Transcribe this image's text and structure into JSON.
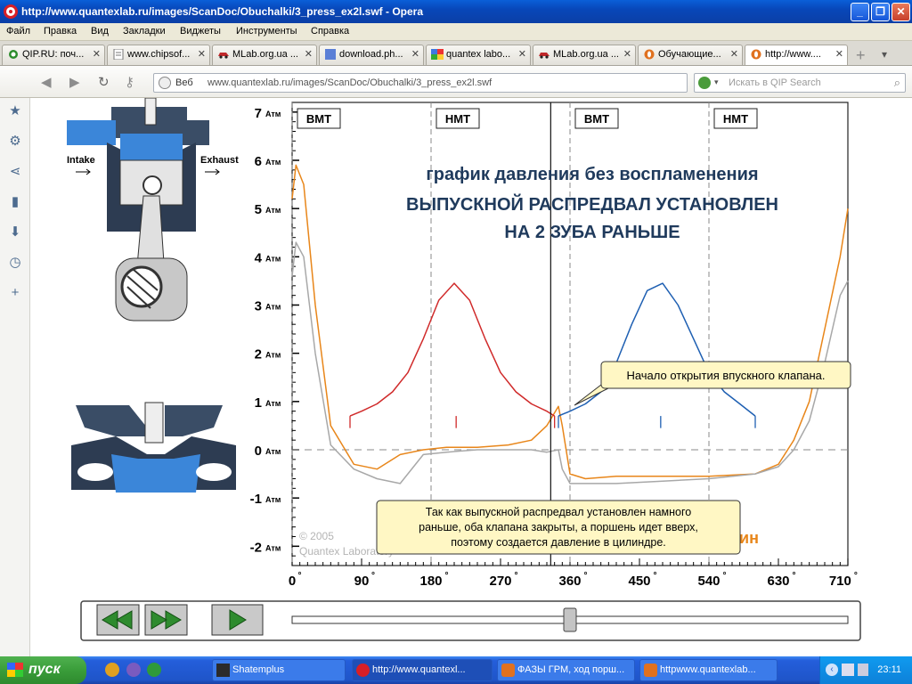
{
  "window": {
    "title": "http://www.quantexlab.ru/images/ScanDoc/Obuchalki/3_press_ex2l.swf - Opera",
    "buttons": {
      "minimize": "_",
      "maximize": "❐",
      "close": "✕"
    }
  },
  "menu": [
    "Файл",
    "Правка",
    "Вид",
    "Закладки",
    "Виджеты",
    "Инструменты",
    "Справка"
  ],
  "tabs": [
    {
      "label": "QIP.RU: поч...",
      "icon": "qip-icon"
    },
    {
      "label": "www.chipsof...",
      "icon": "page-icon"
    },
    {
      "label": "MLab.org.ua ...",
      "icon": "car-icon"
    },
    {
      "label": "download.ph...",
      "icon": "blue-page-icon"
    },
    {
      "label": "quantex labo...",
      "icon": "google-icon"
    },
    {
      "label": "MLab.org.ua ...",
      "icon": "car-icon"
    },
    {
      "label": "Обучающие...",
      "icon": "opera-icon"
    },
    {
      "label": "http://www....",
      "icon": "opera-icon"
    }
  ],
  "address": {
    "web_label": "Веб",
    "url": "www.quantexlab.ru/images/ScanDoc/Obuchalki/3_press_ex2l.swf",
    "search_placeholder": "Искать в QIP Search"
  },
  "flash": {
    "intake_label": "Intake",
    "exhaust_label": "Exhaust",
    "title_line1": "график давления без воспламенения",
    "title_line2": "ВЫПУСКНОЙ РАСПРЕДВАЛ УСТАНОВЛЕН",
    "title_line3": "НА 2 ЗУБА РАНЬШЕ",
    "tdc_bdc_labels": [
      "ВМТ",
      "НМТ",
      "ВМТ",
      "НМТ"
    ],
    "callout_intake": "Начало открытия впускного клапана.",
    "callout_exhaust_lines": [
      "Так как выпускной распредвал установлен намного",
      "раньше, оба клапана закрыты, а поршень идет вверх,",
      "поэтому создается давление в цилиндре."
    ],
    "copyright_lines": [
      "© 2005",
      "Quantex Laboratory"
    ],
    "partial_word": "ин",
    "y_unit": "Атм",
    "x_unit": "°",
    "colors": {
      "orange": "#e8861a",
      "grey": "#a8a8a8",
      "red": "#d02a2a",
      "blue": "#1e5fb2",
      "title": "#1f3a5c"
    }
  },
  "chart_data": {
    "type": "line",
    "title": "график давления без воспламенения",
    "subtitle": "ВЫПУСКНОЙ РАСПРЕДВАЛ УСТАНОВЛЕН НА 2 ЗУБА РАНЬШЕ",
    "xlabel": "",
    "ylabel": "",
    "xlim": [
      0,
      720
    ],
    "ylim": [
      -2.4,
      7.2
    ],
    "x_ticks": [
      "0",
      "90",
      "180",
      "270",
      "360",
      "450",
      "540",
      "630",
      "710"
    ],
    "y_ticks": [
      "7",
      "6",
      "5",
      "4",
      "3",
      "2",
      "1",
      "0",
      "-1",
      "-2"
    ],
    "dashed_verticals": [
      0,
      180,
      360,
      540
    ],
    "cursor_x": 335,
    "zero_line": 0,
    "series": [
      {
        "color": "orange",
        "x": [
          0,
          5,
          15,
          30,
          50,
          80,
          110,
          140,
          170,
          200,
          240,
          280,
          310,
          330,
          345,
          350,
          360,
          380,
          420,
          480,
          540,
          600,
          630,
          650,
          670,
          690,
          710,
          720
        ],
        "y": [
          5.2,
          5.9,
          5.5,
          3.0,
          0.5,
          -0.3,
          -0.4,
          -0.1,
          0.0,
          0.05,
          0.05,
          0.1,
          0.2,
          0.5,
          0.9,
          0.5,
          -0.5,
          -0.6,
          -0.55,
          -0.55,
          -0.55,
          -0.5,
          -0.3,
          0.2,
          1.0,
          2.5,
          4.0,
          5.0
        ]
      },
      {
        "color": "grey",
        "x": [
          0,
          5,
          15,
          30,
          50,
          80,
          110,
          140,
          170,
          200,
          240,
          280,
          310,
          330,
          345,
          350,
          360,
          380,
          420,
          480,
          540,
          600,
          630,
          650,
          670,
          690,
          710,
          720
        ],
        "y": [
          3.6,
          4.3,
          4.0,
          2.0,
          0.1,
          -0.4,
          -0.6,
          -0.7,
          -0.1,
          -0.05,
          0.0,
          0.0,
          0.0,
          -0.05,
          0.0,
          -0.4,
          -0.7,
          -0.7,
          -0.7,
          -0.65,
          -0.6,
          -0.5,
          -0.35,
          0.0,
          0.6,
          1.8,
          3.2,
          3.5
        ]
      },
      {
        "color": "red",
        "x": [
          75,
          90,
          110,
          130,
          150,
          170,
          190,
          210,
          230,
          250,
          270,
          290,
          310,
          330,
          340
        ],
        "y": [
          0.7,
          0.8,
          0.95,
          1.2,
          1.6,
          2.3,
          3.1,
          3.45,
          3.1,
          2.3,
          1.6,
          1.2,
          0.95,
          0.8,
          0.7
        ]
      },
      {
        "color": "blue",
        "x": [
          345,
          360,
          380,
          400,
          420,
          440,
          460,
          480,
          500,
          520,
          540,
          560,
          580,
          600
        ],
        "y": [
          0.7,
          0.8,
          0.95,
          1.2,
          1.8,
          2.6,
          3.3,
          3.45,
          3.0,
          2.3,
          1.6,
          1.2,
          0.95,
          0.7
        ]
      }
    ]
  },
  "controls": {
    "rewind": "rewind-button",
    "fast_forward": "fast-forward-button",
    "play": "play-button",
    "progress": 0.5
  },
  "taskbar": {
    "start_label": "пуск",
    "tasks": [
      {
        "label": "Shatemplus"
      },
      {
        "label": "http://www.quantexl..."
      },
      {
        "label": "ФАЗЫ ГРМ, ход порш..."
      },
      {
        "label": "httpwww.quantexlab..."
      }
    ],
    "clock": "23:11"
  }
}
